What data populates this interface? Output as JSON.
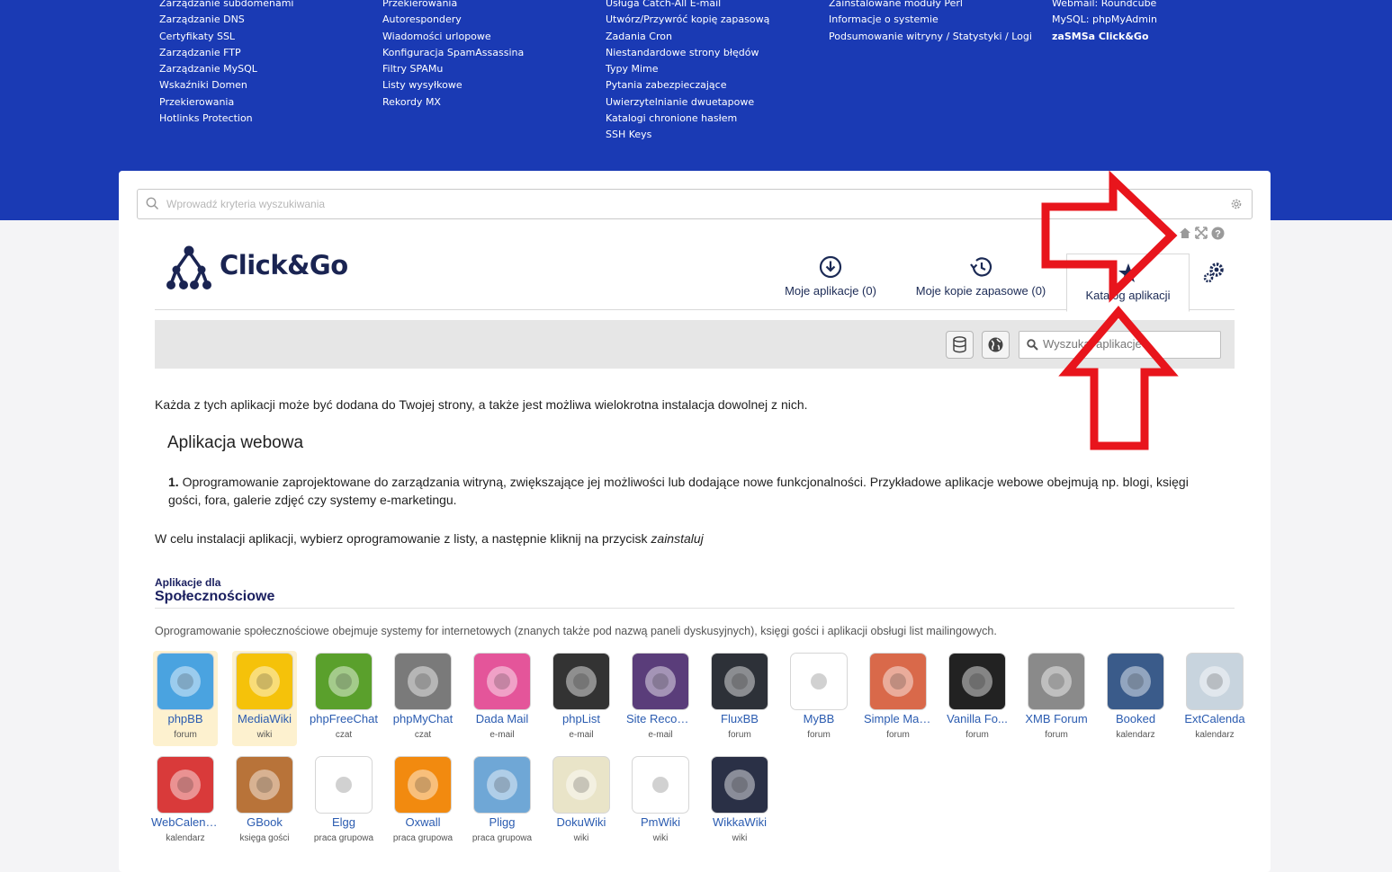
{
  "top_menu": {
    "columns": [
      [
        "Zarządzanie subdomenami",
        "Zarządzanie DNS",
        "Certyfikaty SSL",
        "Zarządzanie FTP",
        "Zarządzanie MySQL",
        "Wskaźniki Domen",
        "Przekierowania",
        "Hotlinks Protection"
      ],
      [
        "Przekierowania",
        "Autorespondery",
        "Wiadomości urlopowe",
        "Konfiguracja SpamAssassina",
        "Filtry SPAMu",
        "Listy wysyłkowe",
        "Rekordy MX"
      ],
      [
        "Usługa Catch-All E-mail",
        "Utwórz/Przywróć kopię zapasową",
        "Zadania Cron",
        "Niestandardowe strony błędów",
        "Typy Mime",
        "Pytania zabezpieczające",
        "Uwierzytelnianie dwuetapowe",
        "Katalogi chronione hasłem",
        "SSH Keys"
      ],
      [
        "Zainstalowane moduły Perl",
        "Informacje o systemie",
        "Podsumowanie witryny / Statystyki / Logi"
      ],
      [
        "Webmail: Roundcube",
        "MySQL: phpMyAdmin",
        "zaSMSa Click&Go"
      ]
    ]
  },
  "search": {
    "placeholder": "Wprowadź kryteria wyszukiwania"
  },
  "logo": {
    "text": "Click&Go"
  },
  "tabs": [
    {
      "label": "Moje aplikacje (0)",
      "icon": "download-circle-icon"
    },
    {
      "label": "Moje kopie zapasowe (0)",
      "icon": "history-icon"
    },
    {
      "label": "Katalog aplikacji",
      "icon": "star-icon"
    }
  ],
  "app_search": {
    "placeholder": "Wyszukaj aplikacje"
  },
  "content": {
    "intro": "Każda z tych aplikacji może być dodana do Twojej strony, a także jest możliwa wielokrotna instalacja dowolnej z nich.",
    "webapp_heading": "Aplikacja webowa",
    "para_num": "1.",
    "para_text": "Oprogramowanie zaprojektowane do zarządzania witryną, zwiększające jej możliwości lub dodające nowe funkcjonalności. Przykładowe aplikacje webowe obejmują np. blogi, księgi gości, fora, galerie zdjęć czy systemy e-marketingu.",
    "instr_prefix": "W celu instalacji aplikacji, wybierz oprogramowanie z listy, a następnie kliknij na przycisk ",
    "instr_em": "zainstaluj"
  },
  "section": {
    "small": "Aplikacje dla",
    "title": "Społecznościowe",
    "desc": "Oprogramowanie społecznościowe obejmuje systemy for internetowych (znanych także pod nazwą paneli dyskusyjnych), księgi gości i aplikacji obsługi list mailingowych."
  },
  "apps": [
    {
      "name": "phpBB",
      "cat": "forum",
      "color": "#4aa3e0",
      "icon": "phpbb-icon"
    },
    {
      "name": "MediaWiki",
      "cat": "wiki",
      "color": "#f5c20a",
      "icon": "sunflower-icon"
    },
    {
      "name": "phpFreeChat",
      "cat": "czat",
      "color": "#5aa02c",
      "icon": "parrot-icon"
    },
    {
      "name": "phpMyChat",
      "cat": "czat",
      "color": "#7a7a7a",
      "icon": "chat-bubbles-icon"
    },
    {
      "name": "Dada Mail",
      "cat": "e-mail",
      "color": "#e4559a",
      "icon": "dada-icon"
    },
    {
      "name": "phpList",
      "cat": "e-mail",
      "color": "#333333",
      "icon": "phplist-icon"
    },
    {
      "name": "Site Recom...",
      "cat": "e-mail",
      "color": "#5a3d7a",
      "icon": "megaphone-icon"
    },
    {
      "name": "FluxBB",
      "cat": "forum",
      "color": "#2d3138",
      "icon": "fluxbb-icon"
    },
    {
      "name": "MyBB",
      "cat": "forum",
      "color": "#ffffff",
      "icon": "mybb-icon"
    },
    {
      "name": "Simple Mac...",
      "cat": "forum",
      "color": "#d9694a",
      "icon": "seesaw-icon"
    },
    {
      "name": "Vanilla Fo...",
      "cat": "forum",
      "color": "#222222",
      "icon": "vanilla-icon"
    },
    {
      "name": "XMB Forum",
      "cat": "forum",
      "color": "#8a8a8a",
      "icon": "xmb-icon"
    },
    {
      "name": "Booked",
      "cat": "kalendarz",
      "color": "#3a5b8a",
      "icon": "calendar-icon"
    },
    {
      "name": "ExtCalenda",
      "cat": "kalendarz",
      "color": "#c8d4de",
      "icon": "x2-icon"
    },
    {
      "name": "WebCalendar",
      "cat": "kalendarz",
      "color": "#d93a3a",
      "icon": "webcalendar-icon"
    },
    {
      "name": "GBook",
      "cat": "księga gości",
      "color": "#b87339",
      "icon": "guestbook-icon"
    },
    {
      "name": "Elgg",
      "cat": "praca grupowa",
      "color": "#ffffff",
      "icon": "elgg-icon"
    },
    {
      "name": "Oxwall",
      "cat": "praca grupowa",
      "color": "#f28a0f",
      "icon": "oxwall-icon"
    },
    {
      "name": "Pligg",
      "cat": "praca grupowa",
      "color": "#6fa7d6",
      "icon": "pligg-star-icon"
    },
    {
      "name": "DokuWiki",
      "cat": "wiki",
      "color": "#e9e4c8",
      "icon": "dokuwiki-icon"
    },
    {
      "name": "PmWiki",
      "cat": "wiki",
      "color": "#ffffff",
      "icon": "pmwiki-icon"
    },
    {
      "name": "WikkaWiki",
      "cat": "wiki",
      "color": "#2a3046",
      "icon": "wikka-icon"
    }
  ]
}
